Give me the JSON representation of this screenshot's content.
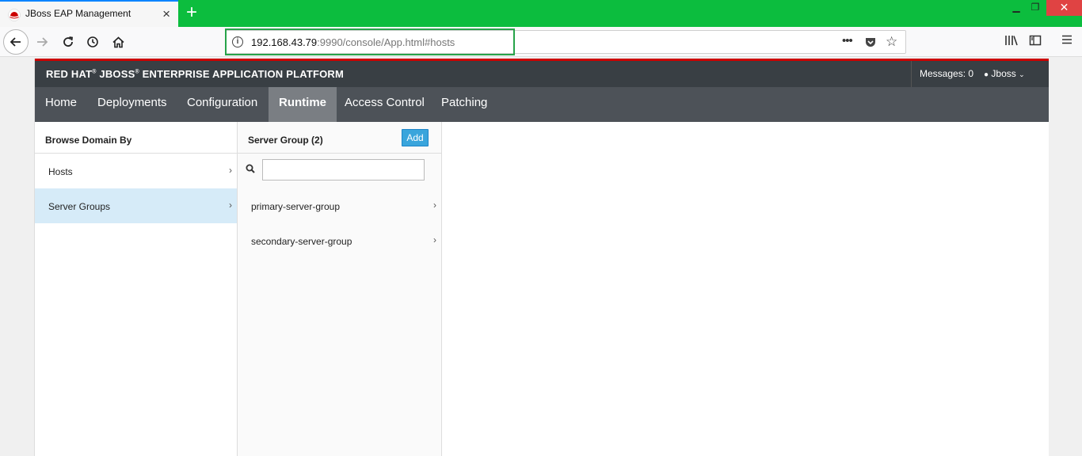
{
  "browser": {
    "tab_title": "JBoss EAP Management",
    "url_host": "192.168.43.79",
    "url_rest": ":9990/console/App.html#hosts",
    "icons": [
      "back-icon",
      "forward-icon",
      "reload-icon",
      "history-icon",
      "home-icon",
      "info-icon",
      "more-icon",
      "pocket-icon",
      "bookmark-star-icon",
      "library-icon",
      "sidebar-icon",
      "menu-icon"
    ]
  },
  "header": {
    "brand_bold": "RED HAT",
    "brand_mid": "JBOSS",
    "brand_rest": "ENTERPRISE APPLICATION PLATFORM",
    "messages": "Messages: 0",
    "user": "Jboss"
  },
  "menu": {
    "items": [
      {
        "label": "Home"
      },
      {
        "label": "Deployments"
      },
      {
        "label": "Configuration"
      },
      {
        "label": "Runtime"
      },
      {
        "label": "Access Control"
      },
      {
        "label": "Patching"
      }
    ]
  },
  "browse": {
    "title": "Browse Domain By",
    "items": [
      {
        "label": "Hosts"
      },
      {
        "label": "Server Groups"
      }
    ]
  },
  "server_group": {
    "title": "Server Group (2)",
    "add_label": "Add",
    "filter_value": "",
    "items": [
      {
        "label": "primary-server-group"
      },
      {
        "label": "secondary-server-group"
      }
    ]
  },
  "colors": {
    "tabstrip": "#0cbd3e",
    "brandbar": "#393f44",
    "menubar": "#4d5258",
    "selected_row": "#d6ebf8",
    "accent": "#39a5dc"
  }
}
